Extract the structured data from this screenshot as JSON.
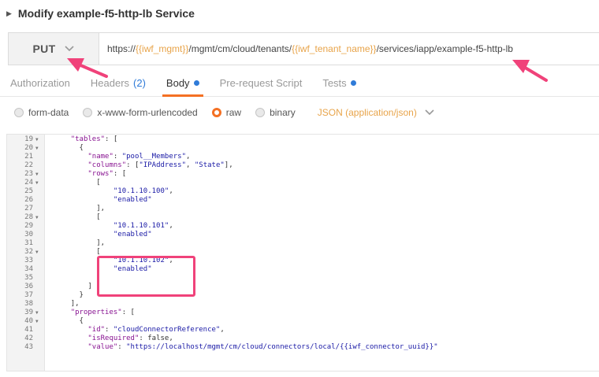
{
  "request": {
    "title": "Modify example-f5-http-lb Service",
    "method": "PUT",
    "url_parts": [
      {
        "text": "https://",
        "var": false
      },
      {
        "text": "{{iwf_mgmt}}",
        "var": true
      },
      {
        "text": "/mgmt/cm/cloud/tenants/",
        "var": false
      },
      {
        "text": "{{iwf_tenant_name}}",
        "var": true
      },
      {
        "text": "/services/iapp/example-f5-http-lb",
        "var": false
      }
    ]
  },
  "tabs": [
    {
      "label": "Authorization",
      "active": false
    },
    {
      "label": "Headers",
      "count": "(2)",
      "active": false
    },
    {
      "label": "Body",
      "dot": true,
      "active": true
    },
    {
      "label": "Pre-request Script",
      "active": false
    },
    {
      "label": "Tests",
      "dot": true,
      "active": false
    }
  ],
  "body_types": [
    {
      "label": "form-data",
      "checked": false
    },
    {
      "label": "x-www-form-urlencoded",
      "checked": false
    },
    {
      "label": "raw",
      "checked": true
    },
    {
      "label": "binary",
      "checked": false
    }
  ],
  "content_type": "JSON (application/json)",
  "editor": {
    "lines": [
      {
        "n": "19",
        "fold": true,
        "indent": "    ",
        "parts": [
          {
            "t": "\"tables\"",
            "c": "k"
          },
          {
            "t": ": [",
            "c": ""
          }
        ]
      },
      {
        "n": "20",
        "fold": true,
        "indent": "      ",
        "parts": [
          {
            "t": "{",
            "c": ""
          }
        ]
      },
      {
        "n": "21",
        "fold": false,
        "indent": "        ",
        "parts": [
          {
            "t": "\"name\"",
            "c": "k"
          },
          {
            "t": ": ",
            "c": ""
          },
          {
            "t": "\"pool__Members\"",
            "c": "s"
          },
          {
            "t": ",",
            "c": ""
          }
        ]
      },
      {
        "n": "22",
        "fold": false,
        "indent": "        ",
        "parts": [
          {
            "t": "\"columns\"",
            "c": "k"
          },
          {
            "t": ": [",
            "c": ""
          },
          {
            "t": "\"IPAddress\"",
            "c": "s"
          },
          {
            "t": ", ",
            "c": ""
          },
          {
            "t": "\"State\"",
            "c": "s"
          },
          {
            "t": "],",
            "c": ""
          }
        ]
      },
      {
        "n": "23",
        "fold": true,
        "indent": "        ",
        "parts": [
          {
            "t": "\"rows\"",
            "c": "k"
          },
          {
            "t": ": [",
            "c": ""
          }
        ]
      },
      {
        "n": "24",
        "fold": true,
        "indent": "          ",
        "parts": [
          {
            "t": "[",
            "c": ""
          }
        ]
      },
      {
        "n": "25",
        "fold": false,
        "indent": "              ",
        "parts": [
          {
            "t": "\"10.1.10.100\"",
            "c": "s"
          },
          {
            "t": ",",
            "c": ""
          }
        ]
      },
      {
        "n": "26",
        "fold": false,
        "indent": "              ",
        "parts": [
          {
            "t": "\"enabled\"",
            "c": "s"
          }
        ]
      },
      {
        "n": "27",
        "fold": false,
        "indent": "          ",
        "parts": [
          {
            "t": "],",
            "c": ""
          }
        ]
      },
      {
        "n": "28",
        "fold": true,
        "indent": "          ",
        "parts": [
          {
            "t": "[",
            "c": ""
          }
        ]
      },
      {
        "n": "29",
        "fold": false,
        "indent": "              ",
        "parts": [
          {
            "t": "\"10.1.10.101\"",
            "c": "s"
          },
          {
            "t": ",",
            "c": ""
          }
        ]
      },
      {
        "n": "30",
        "fold": false,
        "indent": "              ",
        "parts": [
          {
            "t": "\"enabled\"",
            "c": "s"
          }
        ]
      },
      {
        "n": "31",
        "fold": false,
        "indent": "          ",
        "parts": [
          {
            "t": "],",
            "c": ""
          }
        ]
      },
      {
        "n": "32",
        "fold": true,
        "indent": "          ",
        "parts": [
          {
            "t": "[",
            "c": ""
          }
        ]
      },
      {
        "n": "33",
        "fold": false,
        "indent": "              ",
        "parts": [
          {
            "t": "\"10.1.10.102\"",
            "c": "s"
          },
          {
            "t": ",",
            "c": ""
          }
        ]
      },
      {
        "n": "34",
        "fold": false,
        "indent": "              ",
        "parts": [
          {
            "t": "\"enabled\"",
            "c": "s"
          }
        ]
      },
      {
        "n": "35",
        "fold": false,
        "indent": "          ",
        "parts": [
          {
            "t": "]",
            "c": ""
          }
        ]
      },
      {
        "n": "36",
        "fold": false,
        "indent": "        ",
        "parts": [
          {
            "t": "]",
            "c": ""
          }
        ]
      },
      {
        "n": "37",
        "fold": false,
        "indent": "      ",
        "parts": [
          {
            "t": "}",
            "c": ""
          }
        ]
      },
      {
        "n": "38",
        "fold": false,
        "indent": "    ",
        "parts": [
          {
            "t": "],",
            "c": ""
          }
        ]
      },
      {
        "n": "39",
        "fold": true,
        "indent": "    ",
        "parts": [
          {
            "t": "\"properties\"",
            "c": "k"
          },
          {
            "t": ": [",
            "c": ""
          }
        ]
      },
      {
        "n": "40",
        "fold": true,
        "indent": "      ",
        "parts": [
          {
            "t": "{",
            "c": ""
          }
        ]
      },
      {
        "n": "41",
        "fold": false,
        "indent": "        ",
        "parts": [
          {
            "t": "\"id\"",
            "c": "k"
          },
          {
            "t": ": ",
            "c": ""
          },
          {
            "t": "\"cloudConnectorReference\"",
            "c": "s"
          },
          {
            "t": ",",
            "c": ""
          }
        ]
      },
      {
        "n": "42",
        "fold": false,
        "indent": "        ",
        "parts": [
          {
            "t": "\"isRequired\"",
            "c": "k"
          },
          {
            "t": ": false,",
            "c": ""
          }
        ]
      },
      {
        "n": "43",
        "fold": false,
        "indent": "        ",
        "parts": [
          {
            "t": "\"value\"",
            "c": "k"
          },
          {
            "t": ": ",
            "c": ""
          },
          {
            "t": "\"https://localhost/mgmt/cm/cloud/connectors/local/{{iwf_connector_uuid}}\"",
            "c": "s"
          }
        ]
      }
    ]
  },
  "colors": {
    "accent": "#f47023",
    "annotation": "#f0427a",
    "variable": "#e8a44a",
    "tab_dot": "#2f7bd8"
  }
}
